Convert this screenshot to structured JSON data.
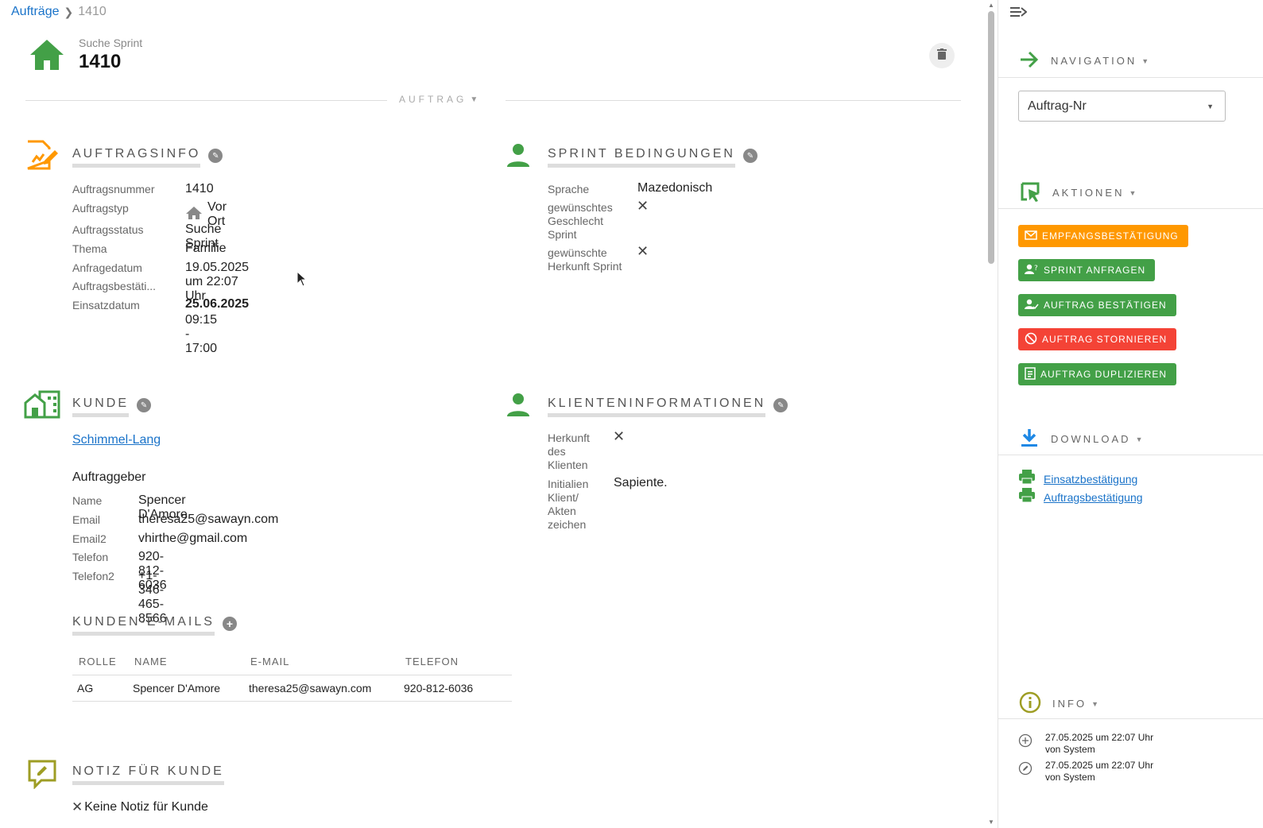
{
  "breadcrumb": {
    "parent": "Aufträge",
    "current": "1410"
  },
  "header": {
    "subtitle": "Suche Sprint",
    "title": "1410"
  },
  "divider": {
    "label": "AUFTRAG"
  },
  "auftragsinfo": {
    "title": "AUFTRAGSINFO",
    "rows": [
      {
        "label": "Auftragsnummer",
        "value": "1410"
      },
      {
        "label": "Auftragstyp",
        "value": "Vor Ort"
      },
      {
        "label": "Auftragsstatus",
        "value": "Suche Sprint"
      },
      {
        "label": "Thema",
        "value": "Familie"
      },
      {
        "label": "Anfragedatum",
        "value": "19.05.2025 um 22:07 Uhr"
      },
      {
        "label": "Auftragsbestäti...",
        "value": ""
      },
      {
        "label": "Einsatzdatum",
        "value": "25.06.2025",
        "value2": "09:15 - 17:00"
      }
    ]
  },
  "sprint": {
    "title": "SPRINT BEDINGUNGEN",
    "rows": [
      {
        "label": "Sprache",
        "value": "Mazedonisch"
      },
      {
        "label": "gewünschtes Geschlecht Sprint",
        "value": "✕"
      },
      {
        "label": "gewünschte Herkunft Sprint",
        "value": "✕"
      }
    ]
  },
  "kunde": {
    "title": "KUNDE",
    "company": "Schimmel-Lang",
    "subheading": "Auftraggeber",
    "rows": [
      {
        "label": "Name",
        "value": "Spencer D'Amore"
      },
      {
        "label": "Email",
        "value": "theresa25@sawayn.com"
      },
      {
        "label": "Email2",
        "value": "vhirthe@gmail.com"
      },
      {
        "label": "Telefon",
        "value": "920-812-6036"
      },
      {
        "label": "Telefon2",
        "value": "+1-346-465-8566"
      }
    ]
  },
  "klient": {
    "title": "KLIENTENINFORMATIONEN",
    "rows": [
      {
        "label": "Herkunft des Klienten",
        "value": "✕"
      },
      {
        "label": "Initialien Klient/ Akten zeichen",
        "value": "Sapiente."
      }
    ]
  },
  "kunden_emails": {
    "title": "KUNDEN-E-MAILS",
    "columns": [
      "ROLLE",
      "NAME",
      "E-MAIL",
      "TELEFON"
    ],
    "rows": [
      [
        "AG",
        "Spencer D'Amore",
        "theresa25@sawayn.com",
        "920-812-6036"
      ]
    ]
  },
  "notiz": {
    "title": "NOTIZ FÜR KUNDE",
    "empty_text": "Keine Notiz für Kunde"
  },
  "right_panel": {
    "navigation": {
      "title": "NAVIGATION",
      "select_value": "Auftrag-Nr"
    },
    "aktionen": {
      "title": "AKTIONEN",
      "buttons": [
        {
          "label": "EMPFANGSBESTÄTIGUNG",
          "color": "#ff9800",
          "icon": "mail-icon"
        },
        {
          "label": "SPRINT ANFRAGEN",
          "color": "#43a047",
          "icon": "person-question-icon"
        },
        {
          "label": "AUFTRAG BESTÄTIGEN",
          "color": "#43a047",
          "icon": "person-check-icon"
        },
        {
          "label": "AUFTRAG STORNIEREN",
          "color": "#f44336",
          "icon": "cancel-icon"
        },
        {
          "label": "AUFTRAG DUPLIZIEREN",
          "color": "#43a047",
          "icon": "duplicate-icon"
        }
      ]
    },
    "download": {
      "title": "DOWNLOAD",
      "links": [
        "Einsatzbestätigung",
        "Auftragsbestätigung"
      ]
    },
    "info": {
      "title": "INFO",
      "entries": [
        {
          "date": "27.05.2025 um 22:07 Uhr",
          "by": "von System",
          "icon": "plus-circle-icon"
        },
        {
          "date": "27.05.2025 um 22:07 Uhr",
          "by": "von System",
          "icon": "edit-circle-icon"
        }
      ]
    }
  },
  "colors": {
    "green": "#43a047",
    "orange": "#ff9800",
    "red": "#f44336",
    "olive": "#9e9d24",
    "link": "#1a73c9",
    "blue": "#1e88e5"
  }
}
